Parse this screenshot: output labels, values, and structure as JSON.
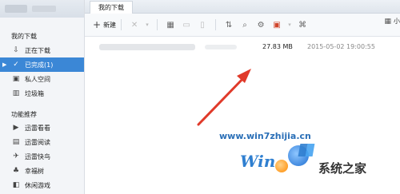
{
  "sidebar": {
    "section1_title": "我的下载",
    "items": [
      {
        "label": "正在下载",
        "icon": "download-icon",
        "glyph": "⇩"
      },
      {
        "label": "已完成(1)",
        "icon": "check-icon",
        "glyph": "✓",
        "active": true
      },
      {
        "label": "私人空间",
        "icon": "private-space-icon",
        "glyph": "▣"
      },
      {
        "label": "垃圾箱",
        "icon": "trash-icon",
        "glyph": "🗑"
      }
    ],
    "section2_title": "功能推荐",
    "features": [
      {
        "label": "迅雷看看",
        "icon": "video-icon",
        "glyph": "▶"
      },
      {
        "label": "迅雷阅读",
        "icon": "book-icon",
        "glyph": "▤"
      },
      {
        "label": "迅雷快鸟",
        "icon": "bird-icon",
        "glyph": "✈"
      },
      {
        "label": "幸福树",
        "icon": "tree-icon",
        "glyph": "♣"
      },
      {
        "label": "休闲游戏",
        "icon": "game-icon",
        "glyph": "◧"
      }
    ]
  },
  "tabs": {
    "active_tab": "我的下载"
  },
  "toolbar": {
    "new_label": "新建",
    "right_label": "小",
    "icons": [
      "close-icon",
      "layout-icon",
      "folder-icon",
      "file-icon",
      "sort-icon",
      "search-icon",
      "settings-icon",
      "gift-icon",
      "gamepad-icon"
    ]
  },
  "list": {
    "rows": [
      {
        "size": "27.83 MB",
        "time": "2015-05-02 19:00:55"
      }
    ]
  },
  "watermark": {
    "url": "www.win7zhijia.cn",
    "logo": "Win",
    "text": "系统之家"
  }
}
